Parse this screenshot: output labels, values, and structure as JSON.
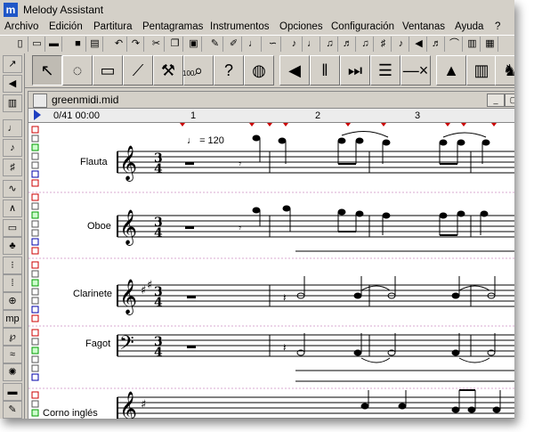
{
  "app": {
    "title": "Melody Assistant",
    "icon_letter": "m"
  },
  "menu": [
    "Archivo",
    "Edición",
    "Partitura",
    "Pentagramas",
    "Instrumentos",
    "Opciones",
    "Configuración",
    "Ventanas",
    "Ayuda",
    "?"
  ],
  "toolbar_icons": [
    "new-doc-icon",
    "open-icon",
    "open-folder-icon",
    "save-icon",
    "print-icon",
    "undo-icon",
    "redo-icon",
    "cut-icon",
    "copy-icon",
    "paste-icon",
    "brush-icon",
    "note-icon",
    "paint-icon",
    "note-8th-icon",
    "note-16th-icon",
    "note-group-icon",
    "note-chord-icon",
    "note-sharp-icon",
    "note-tied-icon",
    "speaker-icon",
    "note-run-icon",
    "fan-icon",
    "bars-icon",
    "grid-icon"
  ],
  "big_tools": [
    {
      "icon": "pointer-icon",
      "glyph": "↖"
    },
    {
      "icon": "lasso-icon",
      "glyph": "◌"
    },
    {
      "icon": "eraser-icon",
      "glyph": "▭"
    },
    {
      "icon": "clarinet-icon",
      "glyph": "⟋"
    },
    {
      "icon": "hammer-icon",
      "glyph": "⚒"
    },
    {
      "icon": "zoom-icon",
      "glyph": "⌕"
    },
    {
      "icon": "help-icon",
      "glyph": "?"
    },
    {
      "icon": "globe-icon",
      "glyph": "◍"
    },
    {
      "icon": "speaker-icon",
      "glyph": "◀"
    },
    {
      "icon": "pause-icon",
      "glyph": "‖"
    },
    {
      "icon": "rewind-icon",
      "glyph": "⏭"
    },
    {
      "icon": "list-icon",
      "glyph": "☰"
    },
    {
      "icon": "loop-icon",
      "glyph": "—×"
    },
    {
      "icon": "metronome-icon",
      "glyph": "▲"
    },
    {
      "icon": "organ-icon",
      "glyph": "▥"
    },
    {
      "icon": "conductor-icon",
      "glyph": "♞"
    },
    {
      "icon": "cap-icon",
      "glyph": "▢"
    }
  ],
  "zoom_label": "100",
  "left_tools": [
    "select-tool-icon",
    "speaker-tool-icon",
    "piano-tool-icon",
    "note-tool-icon",
    "eighth-tool-icon",
    "sharp-tool-icon",
    "trill-tool-icon",
    "accent-tool-icon",
    "fermata-tool-icon",
    "chord-tool-icon",
    "fingering-tool-icon",
    "repeat-tool-icon",
    "coda-tool-icon",
    "dynamics-tool-icon",
    "pedal-tool-icon",
    "glissando-tool-icon",
    "gear-tool-icon",
    "line-tool-icon",
    "pen-tool-icon"
  ],
  "document": {
    "filename": "greenmidi.mid",
    "counter": "0/41 00:00",
    "bars": [
      "1",
      "2",
      "3"
    ],
    "tempo": "= 120",
    "parts": [
      {
        "name": "Flauta",
        "clef": "treble",
        "key": "",
        "time_top": "3",
        "time_bottom": "4"
      },
      {
        "name": "Oboe",
        "clef": "treble",
        "key": "",
        "time_top": "3",
        "time_bottom": "4"
      },
      {
        "name": "Clarinete",
        "clef": "treble",
        "key": "##",
        "time_top": "3",
        "time_bottom": "4"
      },
      {
        "name": "Fagot",
        "clef": "bass",
        "key": "",
        "time_top": "3",
        "time_bottom": "4"
      },
      {
        "name": "Corno inglés",
        "clef": "treble",
        "key": "#",
        "time_top": "",
        "time_bottom": ""
      }
    ]
  }
}
